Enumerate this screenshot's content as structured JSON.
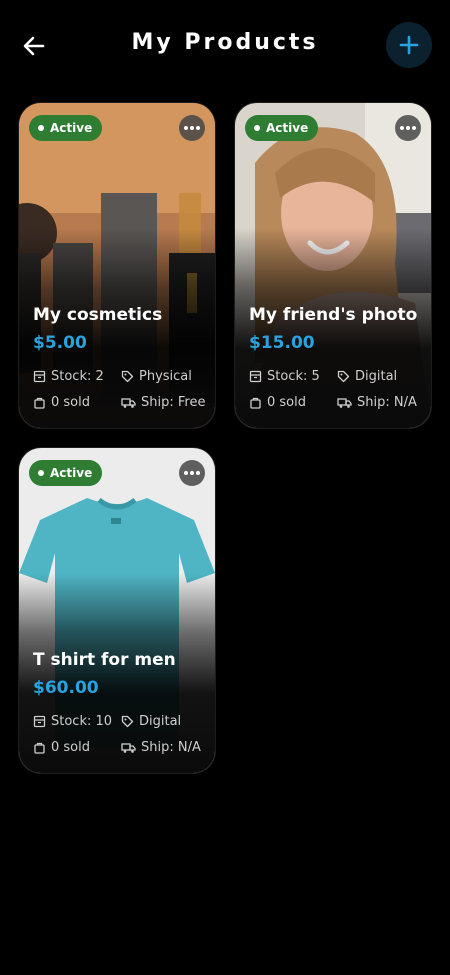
{
  "header": {
    "title": "My Products",
    "back_icon": "arrow-left-icon",
    "add_icon": "plus-icon",
    "accent": "#29a3e0"
  },
  "products": [
    {
      "name": "My cosmetics",
      "price": "$5.00",
      "status": "Active",
      "stock": "Stock: 2",
      "type": "Physical",
      "sold": "0 sold",
      "ship": "Ship: Free"
    },
    {
      "name": "My friend's photo",
      "price": "$15.00",
      "status": "Active",
      "stock": "Stock: 5",
      "type": "Digital",
      "sold": "0 sold",
      "ship": "Ship: N/A"
    },
    {
      "name": "T shirt for men",
      "price": "$60.00",
      "status": "Active",
      "stock": "Stock: 10",
      "type": "Digital",
      "sold": "0 sold",
      "ship": "Ship: N/A"
    }
  ],
  "colors": {
    "background": "#000000",
    "price": "#29a3e0",
    "active_badge": "#2e7d32"
  }
}
